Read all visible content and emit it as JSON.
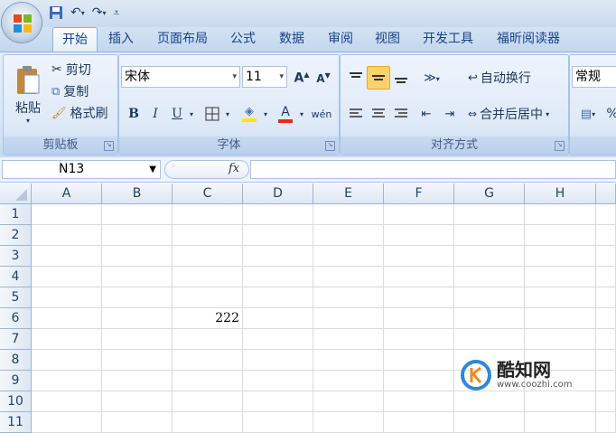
{
  "qat": {
    "save_icon": "save-icon",
    "undo_icon": "undo-icon",
    "redo_icon": "redo-icon",
    "customize_icon": "customize-qat-icon"
  },
  "tabs": [
    {
      "label": "开始",
      "active": true
    },
    {
      "label": "插入"
    },
    {
      "label": "页面布局"
    },
    {
      "label": "公式"
    },
    {
      "label": "数据"
    },
    {
      "label": "审阅"
    },
    {
      "label": "视图"
    },
    {
      "label": "开发工具"
    },
    {
      "label": "福昕阅读器"
    }
  ],
  "clipboard": {
    "paste": "粘贴",
    "cut": "剪切",
    "copy": "复制",
    "format_painter": "格式刷",
    "group": "剪贴板"
  },
  "font": {
    "name": "宋体",
    "size": "11",
    "bold": "B",
    "italic": "I",
    "underline": "U",
    "phonetic": "wén",
    "group": "字体"
  },
  "alignment": {
    "wrap": "自动换行",
    "merge": "合并后居中",
    "group": "对齐方式"
  },
  "number": {
    "format": "常规",
    "percent": "%"
  },
  "namebox": "N13",
  "fx": "fx",
  "columns": [
    "A",
    "B",
    "C",
    "D",
    "E",
    "F",
    "G",
    "H"
  ],
  "rows": [
    "1",
    "2",
    "3",
    "4",
    "5",
    "6",
    "7",
    "8",
    "9",
    "10",
    "11"
  ],
  "cells": {
    "C6": "222"
  },
  "watermark": {
    "brand": "酷知网",
    "url": "www.coozhi.com"
  },
  "colors": {
    "accent": "#15428b",
    "ribbon": "#dbe7f6",
    "font_color_bar": "#e8261b",
    "fill_color_bar": "#ffe600"
  }
}
